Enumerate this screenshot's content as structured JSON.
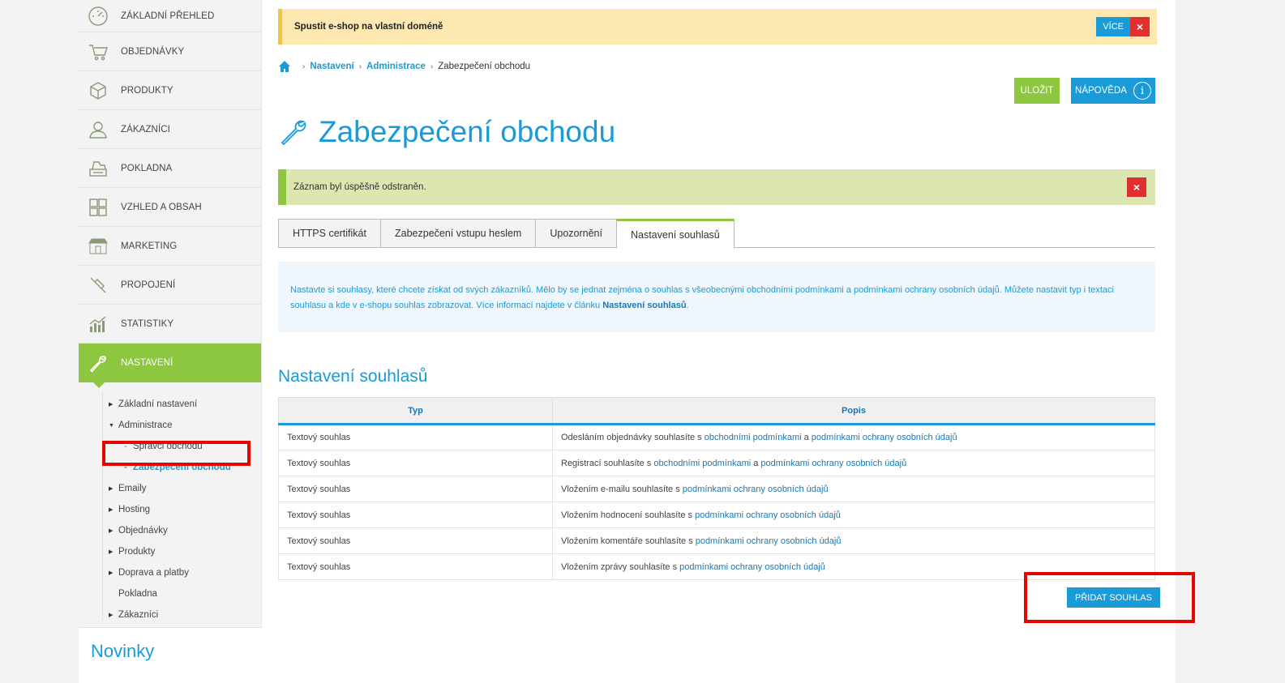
{
  "sidebar": {
    "menu": [
      {
        "label": "ZÁKLADNÍ PŘEHLED",
        "icon": "dashboard-gauge-icon"
      },
      {
        "label": "OBJEDNÁVKY",
        "icon": "shopping-cart-icon"
      },
      {
        "label": "PRODUKTY",
        "icon": "box-icon"
      },
      {
        "label": "ZÁKAZNÍCI",
        "icon": "user-icon"
      },
      {
        "label": "POKLADNA",
        "icon": "cash-register-icon"
      },
      {
        "label": "VZHLED A OBSAH",
        "icon": "layout-grid-icon"
      },
      {
        "label": "MARKETING",
        "icon": "store-icon"
      },
      {
        "label": "PROPOJENÍ",
        "icon": "plug-icon"
      },
      {
        "label": "STATISTIKY",
        "icon": "bar-chart-icon"
      },
      {
        "label": "NASTAVENÍ",
        "icon": "wrench-icon"
      }
    ],
    "submenu": {
      "zakladni": "Základní nastavení",
      "administrace": "Administrace",
      "spravci": "Správci obchodu",
      "zabezpeceni": "Zabezpečení obchodu",
      "emaily": "Emaily",
      "hosting": "Hosting",
      "objednavky": "Objednávky",
      "produkty": "Produkty",
      "doprava": "Doprava a platby",
      "pokladna": "Pokladna",
      "zakaznici": "Zákazníci"
    },
    "news_title": "Novinky"
  },
  "promo": {
    "text": "Spustit e-shop na vlastní doméně",
    "more_label": "VÍCE",
    "close_label": "×"
  },
  "breadcrumb": {
    "nastaveni": "Nastavení",
    "administrace": "Administrace",
    "current": "Zabezpečení obchodu",
    "separator": "›"
  },
  "toolbar": {
    "save_label": "ULOŽIT",
    "help_label": "NÁPOVĚDA",
    "help_icon_glyph": "i"
  },
  "page_title": "Zabezpečení obchodu",
  "success": {
    "text": "Záznam byl úspěšně odstraněn.",
    "close_label": "×"
  },
  "tabs": [
    "HTTPS certifikát",
    "Zabezpečení vstupu heslem",
    "Upozornění",
    "Nastavení souhlasů"
  ],
  "info": {
    "text": "Nastavte si souhlasy, které chcete získat od svých zákazníků. Mělo by se jednat zejména o souhlas s všeobecnými obchodními podmínkami a podmínkami ochrany osobních údajů. Můžete nastavit typ i textaci souhlasu a kde v e-shopu souhlas zobrazovat. Více informací najdete v článku ",
    "link": "Nastavení souhlasů",
    "end": "."
  },
  "section_title": "Nastavení souhlasů",
  "table": {
    "headers": {
      "typ": "Typ",
      "popis": "Popis"
    },
    "rows": [
      {
        "typ": "Textový souhlas",
        "pre": "Odesláním objednávky souhlasíte s ",
        "link1": "obchodními podmínkami",
        "mid": " a ",
        "link2": "podmínkami ochrany osobních údajů"
      },
      {
        "typ": "Textový souhlas",
        "pre": "Registrací souhlasíte s ",
        "link1": "obchodními podmínkami",
        "mid": " a ",
        "link2": "podmínkami ochrany osobních údajů"
      },
      {
        "typ": "Textový souhlas",
        "pre": "Vložením e-mailu souhlasíte s ",
        "link1": "podmínkami ochrany osobních údajů"
      },
      {
        "typ": "Textový souhlas",
        "pre": "Vložením hodnocení souhlasíte s ",
        "link1": "podmínkami ochrany osobních údajů"
      },
      {
        "typ": "Textový souhlas",
        "pre": "Vložením komentáře souhlasíte s ",
        "link1": "podmínkami ochrany osobních údajů"
      },
      {
        "typ": "Textový souhlas",
        "pre": "Vložením zprávy souhlasíte s ",
        "link1": "podmínkami ochrany osobních údajů"
      }
    ]
  },
  "add_button_label": "PŘIDAT SOUHLAS",
  "colors": {
    "accent_green": "#8dc63f",
    "accent_blue": "#1a9bd7",
    "danger_red": "#e0302f",
    "highlight_red": "#e10600"
  }
}
